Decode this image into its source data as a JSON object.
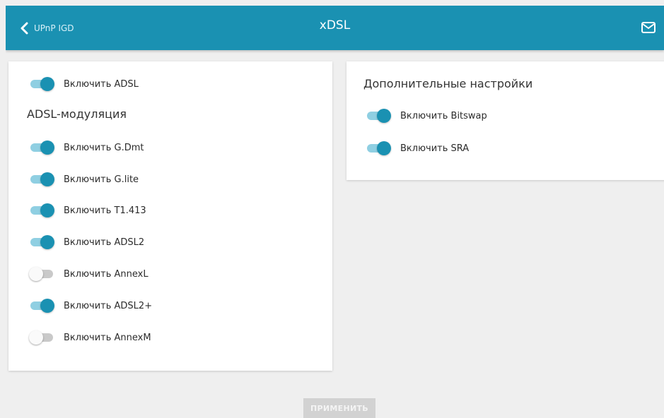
{
  "header": {
    "back_label": "UPnP IGD",
    "title": "xDSL",
    "back_icon": "chevron-left-icon",
    "mail_icon": "mail-icon"
  },
  "colors": {
    "accent": "#1a91b2",
    "toggle_on_track": "#8fcfe2",
    "toggle_off_track": "#c9c9c9",
    "background": "#efefef"
  },
  "left_card": {
    "enable_adsl": {
      "label": "Включить ADSL",
      "on": true
    },
    "modulation_title": "ADSL-модуляция",
    "items": [
      {
        "label": "Включить G.Dmt",
        "on": true
      },
      {
        "label": "Включить G.lite",
        "on": true
      },
      {
        "label": "Включить T1.413",
        "on": true
      },
      {
        "label": "Включить ADSL2",
        "on": true
      },
      {
        "label": "Включить AnnexL",
        "on": false
      },
      {
        "label": "Включить ADSL2+",
        "on": true
      },
      {
        "label": "Включить AnnexM",
        "on": false
      }
    ]
  },
  "right_card": {
    "title": "Дополнительные настройки",
    "items": [
      {
        "label": "Включить Bitswap",
        "on": true
      },
      {
        "label": "Включить SRA",
        "on": true
      }
    ]
  },
  "footer": {
    "apply_label": "ПРИМЕНИТЬ"
  }
}
